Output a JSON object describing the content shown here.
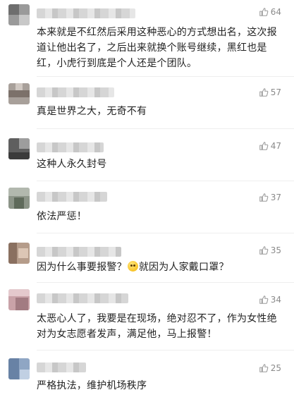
{
  "comments": [
    {
      "likes": "64",
      "text": "本来就是不红然后采用这种恶心的方式想出名，这次报道让他出名了，之后出来就换个账号继续，黑红也是红，小虎行到底是个人还是个团队。"
    },
    {
      "likes": "57",
      "text": "真是世界之大，无奇不有"
    },
    {
      "likes": "47",
      "text": "这种人永久封号"
    },
    {
      "likes": "37",
      "text": "依法严惩！"
    },
    {
      "likes": "35",
      "text_before": "因为什么事要报警？",
      "emoji": "thinking-emoji",
      "text_after": "就因为人家戴口罩？"
    },
    {
      "likes": "34",
      "text": "太恶心人了，我要是在现场，绝对忍不了，作为女性绝对为女志愿者发声，满足他，马上报警！"
    },
    {
      "likes": "25",
      "text": "严格执法，维护机场秩序"
    }
  ],
  "icons": {
    "like": "thumbs-up-icon"
  },
  "colors": {
    "meta_text": "#8a8a8a",
    "body_text": "#222222"
  }
}
